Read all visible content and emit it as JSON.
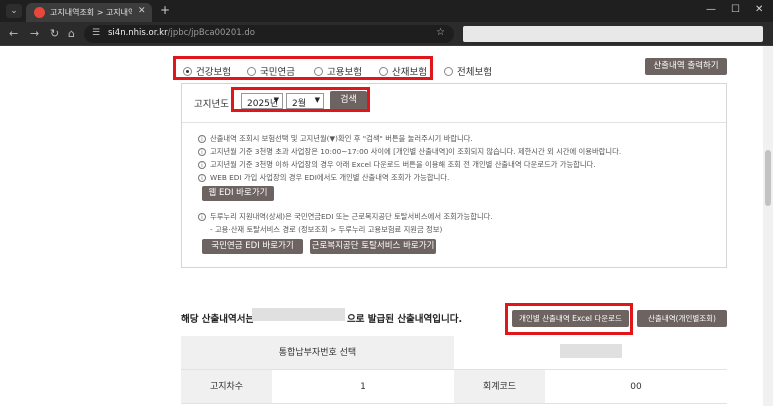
{
  "browser": {
    "tab_title": "고지내역조회 > 고지내역 > 청",
    "tab_close": "✕",
    "new_tab": "+",
    "url_host": "si4n.nhis.or.kr",
    "url_path": "/jpbc/jpBca00201.do",
    "window_controls": [
      "—",
      "☐",
      "✕"
    ]
  },
  "insurance_types": [
    {
      "label": "건강보험",
      "selected": true
    },
    {
      "label": "국민연금",
      "selected": false
    },
    {
      "label": "고용보험",
      "selected": false
    },
    {
      "label": "산재보험",
      "selected": false
    },
    {
      "label": "전체보험",
      "selected": false
    }
  ],
  "print_button": "산출내역 출력하기",
  "search": {
    "label": "고지년도",
    "year": "2025년",
    "month": "2월",
    "button": "검색"
  },
  "info": {
    "lines": [
      "산출내역 조회시 보험선택 및 고지년월(▼)확인 후 \"검색\" 버튼을 눌러주시기 바랍니다.",
      "고지년월 기준 3천명 초과 사업장은 10:00~17:00 사이에 [개인별 산출내역]이 조회되지 않습니다. 제한시간 외 시간에 이용바랍니다.",
      "고지년월 기준 3천명 이하 사업장의 경우 아래 Excel 다운로드 버튼을 이용해 조회 전 개인별 산출내역 다운로드가 가능합니다.",
      "WEB EDI 가입 사업장의 경우 EDI에서도 개인별 산출내역 조회가 가능합니다."
    ],
    "edi_button": "웹 EDI 바로가기",
    "duru_line": "두루누리 지원내역(상세)은 국민연금EDI 또는 근로복지공단 토탈서비스에서 조회가능합니다.",
    "duru_sub": "- 고용·산재 토탈서비스 경로 (정보조회 > 두루누리 고용보험료 지원금 정보)",
    "nps_button": "국민연금 EDI 바로가기",
    "comwel_button": "근로복지공단 토탈서비스 바로가기",
    "icon": "i"
  },
  "result": {
    "prefix": "해당 산출내역서는",
    "suffix": "으로 발급된 산출내역입니다.",
    "excel_button": "개인별 산출내역 Excel 다운로드",
    "personal_button": "산출내역(개인별조회)"
  },
  "table": {
    "payer_label": "통합납부자번호 선택",
    "order_label": "고지차수",
    "order_value": "1",
    "account_label": "회계코드",
    "account_value": "00"
  }
}
